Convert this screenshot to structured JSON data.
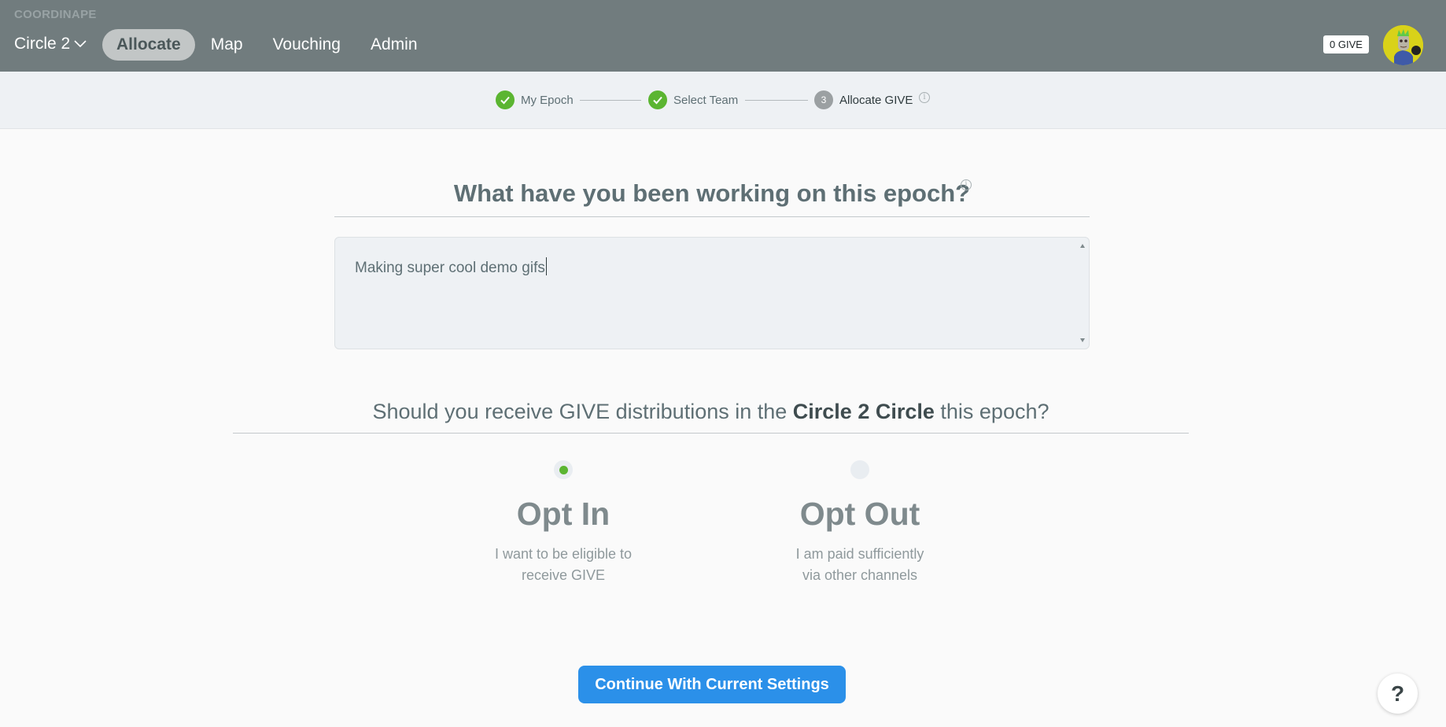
{
  "header": {
    "logo": "COORDINAPE",
    "circle_selector": "Circle 2",
    "nav": [
      "Allocate",
      "Map",
      "Vouching",
      "Admin"
    ],
    "active_nav": "Allocate",
    "give_balance": "0 GIVE",
    "avatar_icon": "user-avatar"
  },
  "stepper": {
    "steps": [
      {
        "label": "My Epoch",
        "state": "done"
      },
      {
        "label": "Select Team",
        "state": "done"
      },
      {
        "label": "Allocate GIVE",
        "state": "current",
        "number": "3"
      }
    ]
  },
  "epoch": {
    "question": "What have you been working on this epoch?",
    "response": "Making super cool demo gifs"
  },
  "distribution": {
    "question_prefix": "Should you receive GIVE distributions in the ",
    "circle_name": "Circle 2 Circle",
    "question_suffix": " this epoch?",
    "options": [
      {
        "title": "Opt In",
        "desc_line1": "I want to be eligible to",
        "desc_line2": "receive GIVE",
        "selected": true
      },
      {
        "title": "Opt Out",
        "desc_line1": "I am paid sufficiently",
        "desc_line2": "via other channels",
        "selected": false
      }
    ]
  },
  "actions": {
    "continue": "Continue With Current Settings",
    "help": "?"
  },
  "colors": {
    "header_bg": "#717c7e",
    "success_green": "#5bb531",
    "primary_blue": "#2b90e9"
  }
}
